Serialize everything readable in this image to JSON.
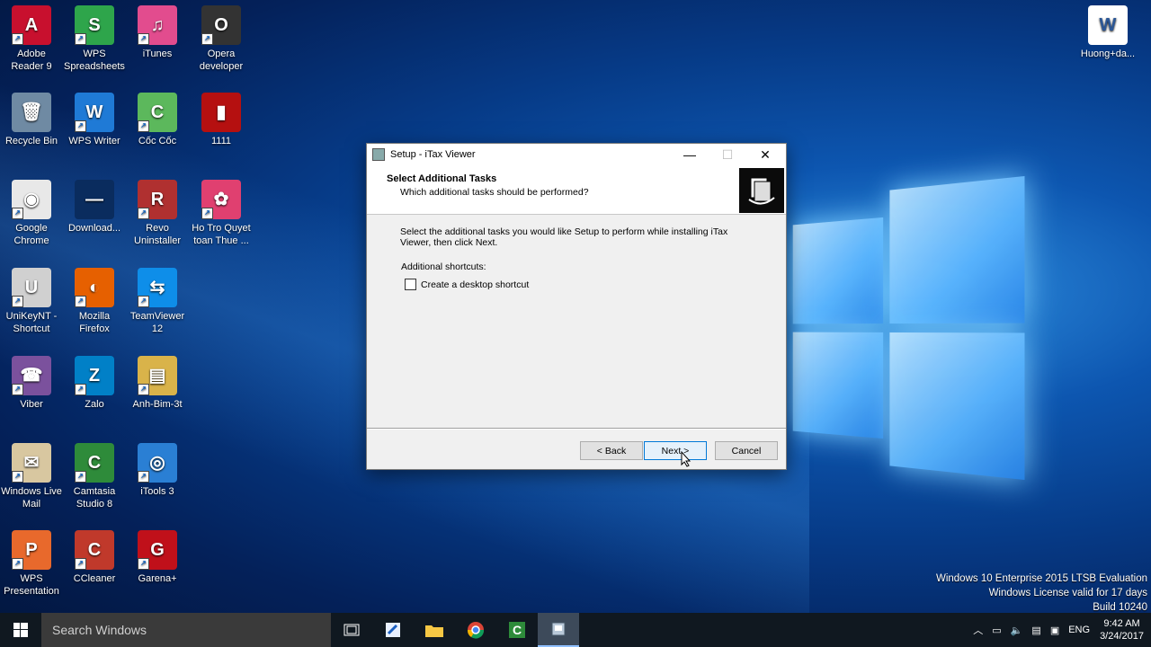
{
  "desktop": {
    "icons": [
      {
        "label": "Adobe Reader 9",
        "color": "#c8102e",
        "glyph": "A"
      },
      {
        "label": "WPS Spreadsheets",
        "color": "#2ea54b",
        "glyph": "S"
      },
      {
        "label": "iTunes",
        "color": "#e24c8e",
        "glyph": "♫"
      },
      {
        "label": "Opera developer",
        "color": "#333333",
        "glyph": "O"
      },
      {
        "label": "Recycle Bin",
        "color": "#6f8aa3",
        "glyph": "🗑"
      },
      {
        "label": "WPS Writer",
        "color": "#1f7ad6",
        "glyph": "W"
      },
      {
        "label": "Cốc Cốc",
        "color": "#5cb85c",
        "glyph": "C"
      },
      {
        "label": "1111",
        "color": "#b51010",
        "glyph": "▮"
      },
      {
        "label": "Google Chrome",
        "color": "#e8e8e8",
        "glyph": "◉"
      },
      {
        "label": "Download...",
        "color": "#0a2c5e",
        "glyph": "―"
      },
      {
        "label": "Revo Uninstaller",
        "color": "#b03030",
        "glyph": "R"
      },
      {
        "label": "Ho Tro Quyet toan Thue ...",
        "color": "#e04070",
        "glyph": "✿"
      },
      {
        "label": "UniKeyNT - Shortcut",
        "color": "#d0d0d0",
        "glyph": "U"
      },
      {
        "label": "Mozilla Firefox",
        "color": "#e66000",
        "glyph": "◐"
      },
      {
        "label": "TeamViewer 12",
        "color": "#0e8ee9",
        "glyph": "⇆"
      },
      {
        "label": "Viber",
        "color": "#7b519d",
        "glyph": "☎"
      },
      {
        "label": "Zalo",
        "color": "#0180c7",
        "glyph": "Z"
      },
      {
        "label": "Anh-Bim-3t",
        "color": "#d9b34a",
        "glyph": "▤"
      },
      {
        "label": "Windows Live Mail",
        "color": "#d8c7a0",
        "glyph": "✉"
      },
      {
        "label": "Camtasia Studio 8",
        "color": "#2e8b3a",
        "glyph": "C"
      },
      {
        "label": "iTools 3",
        "color": "#2a7fd4",
        "glyph": "◎"
      },
      {
        "label": "WPS Presentation",
        "color": "#e8692c",
        "glyph": "P"
      },
      {
        "label": "CCleaner",
        "color": "#c0392b",
        "glyph": "C"
      },
      {
        "label": "Garena+",
        "color": "#c0101a",
        "glyph": "G"
      },
      {
        "label": "Huong+da...",
        "color": "#ffffff",
        "glyph": "W"
      }
    ]
  },
  "dialog": {
    "title": "Setup - iTax Viewer",
    "heading": "Select Additional Tasks",
    "subheading": "Which additional tasks should be performed?",
    "body": "Select the additional tasks you would like Setup to perform while installing iTax Viewer, then click Next.",
    "shortcuts_label": "Additional shortcuts:",
    "checkbox_label": "Create a desktop shortcut",
    "checkbox_checked": false,
    "back_label": "< Back",
    "next_label": "Next >",
    "cancel_label": "Cancel",
    "minimize_glyph": "—",
    "maximize_glyph": "☐",
    "close_glyph": "✕"
  },
  "watermark": {
    "line1": "Windows 10 Enterprise 2015 LTSB Evaluation",
    "line2": "Windows License valid for 17 days",
    "line3": "Build 10240"
  },
  "taskbar": {
    "search_placeholder": "Search Windows",
    "language": "ENG",
    "time": "9:42 AM",
    "date": "3/24/2017"
  }
}
